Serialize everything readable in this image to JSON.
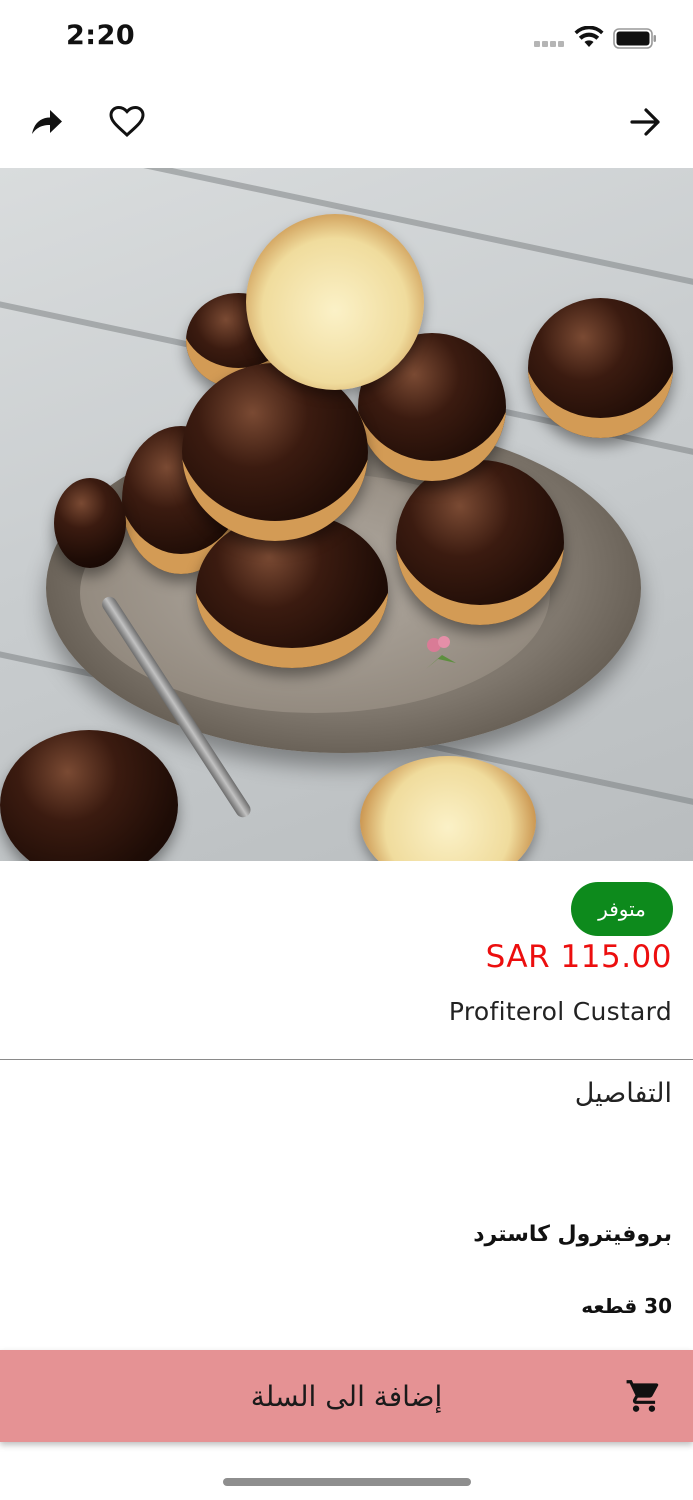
{
  "status_bar": {
    "time": "2:20",
    "signal_icon": "cellular-signal-icon",
    "wifi_icon": "wifi-icon",
    "battery_icon": "battery-icon"
  },
  "nav": {
    "share_icon": "share-icon",
    "favorite_icon": "heart-icon",
    "back_icon": "arrow-right-icon"
  },
  "product": {
    "image_icon": "product-photo",
    "availability": "متوفر",
    "price": "SAR 115.00",
    "name": "Profiterol Custard"
  },
  "details": {
    "title": "التفاصيل",
    "description_line1": "بروفيترول كاسترد",
    "description_line2": "30 قطعه"
  },
  "cart": {
    "label": "إضافة الى السلة",
    "icon": "cart-icon"
  },
  "colors": {
    "availability_badge": "#0d8a1c",
    "price": "#ec0e0e",
    "add_to_cart_bar": "#e59294"
  }
}
